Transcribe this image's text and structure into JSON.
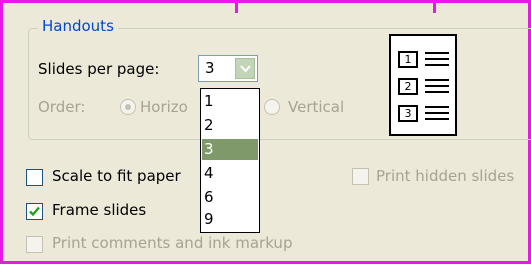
{
  "handouts": {
    "title": "Handouts",
    "slides_per_page_label": "Slides per page:",
    "slides_per_page_value": "3",
    "order_label": "Order:",
    "order_horizontal": "Horizo",
    "order_vertical": "Vertical"
  },
  "dropdown": {
    "options": [
      "1",
      "2",
      "3",
      "4",
      "6",
      "9"
    ],
    "selected": "3"
  },
  "preview": {
    "numbers": [
      "1",
      "2",
      "3"
    ]
  },
  "options": {
    "scale_to_fit_label": "Scale to fit paper",
    "scale_to_fit_checked": false,
    "frame_slides_label": "Frame slides",
    "frame_slides_checked": true,
    "print_hidden_label": "Print hidden slides",
    "print_hidden_checked": false,
    "print_comments_label": "Print comments and ink markup",
    "print_comments_checked": false
  },
  "colors": {
    "accent_frame": "#e619e6",
    "group_title": "#0046d5",
    "selection": "#7f996b"
  }
}
